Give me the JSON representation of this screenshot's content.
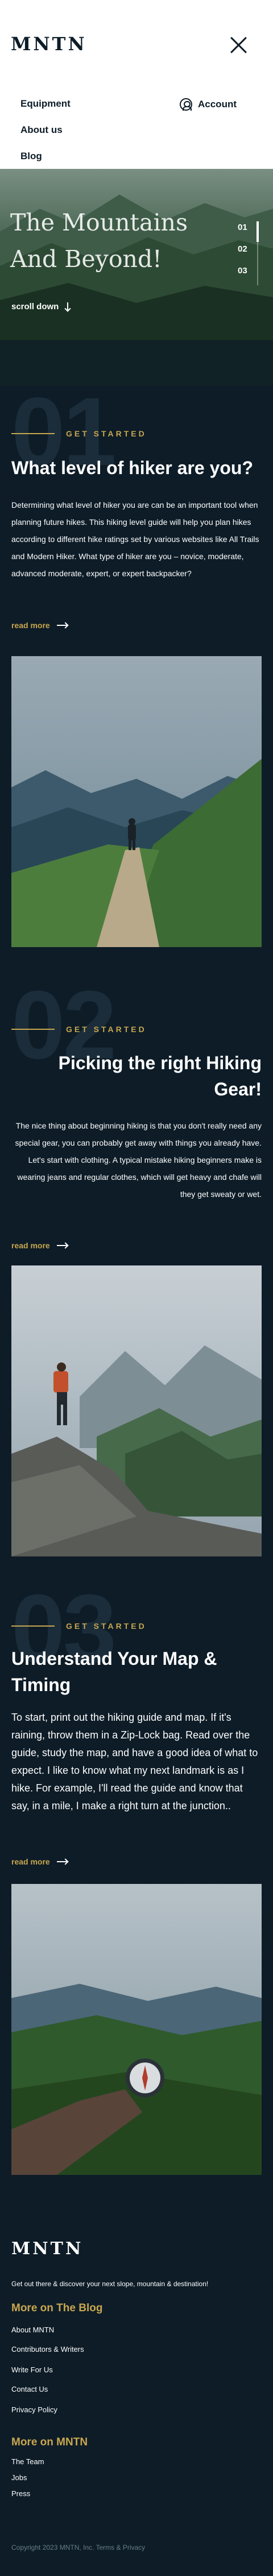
{
  "header": {
    "logo": "MNTN",
    "menu": [
      {
        "label": "Equipment"
      },
      {
        "label": "About us"
      },
      {
        "label": "Blog"
      }
    ],
    "account_label": "Account"
  },
  "hero": {
    "title_line1": "The Mountains",
    "title_line2": "And Beyond!",
    "scroll_label": "scroll down",
    "slides": [
      "01",
      "02",
      "03"
    ],
    "active_slide": 1
  },
  "sections": [
    {
      "number": "01",
      "eyebrow": "GET STARTED",
      "title": "What level of  hiker are you?",
      "text": "Determining what level of hiker you are can be an important tool when planning future hikes. This hiking level guide will help you plan hikes according to different hike ratings set by various websites like All Trails and Modern Hiker. What type of hiker are you – novice, moderate, advanced moderate, expert, or expert backpacker?",
      "read_more": "read more"
    },
    {
      "number": "02",
      "eyebrow": "GET STARTED",
      "title": "Picking the right Hiking Gear!",
      "text": "The nice thing about beginning hiking is that you don't really need any special gear, you can probably get away with things you already have.",
      "text2": "Let's start with clothing. A typical mistake hiking beginners make is wearing jeans and regular clothes, which will get heavy and chafe will they get sweaty or wet.",
      "read_more": "read more"
    },
    {
      "number": "03",
      "eyebrow": "GET STARTED",
      "title": "Understand Your Map & Timing",
      "text": "To start, print out the hiking guide and map. If it's raining, throw them in a Zip-Lock bag. Read over the guide, study the map, and have a good idea of what to expect. I like to know what my next landmark is as I hike. For example, I'll read the guide and know that say, in a mile, I make a right turn at the junction..",
      "read_more": "read more"
    }
  ],
  "footer": {
    "logo": "MNTN",
    "tagline": "Get out there & discover your next slope, mountain & destination!",
    "blog_heading": "More on The Blog",
    "blog_links": [
      "About MNTN",
      "Contributors & Writers",
      "Write For Us",
      "Contact Us",
      "Privacy Policy"
    ],
    "mntn_heading": "More on MNTN",
    "mntn_links": [
      "The Team",
      "Jobs",
      "Press"
    ],
    "copyright": "Copyright 2023 MNTN, Inc. Terms & Privacy"
  },
  "colors": {
    "background": "#0d1c27",
    "accent": "#c8a64f",
    "header_bg": "#ffffff"
  },
  "icons": [
    "close-icon",
    "user-icon",
    "arrow-down-icon",
    "arrow-right-icon"
  ]
}
